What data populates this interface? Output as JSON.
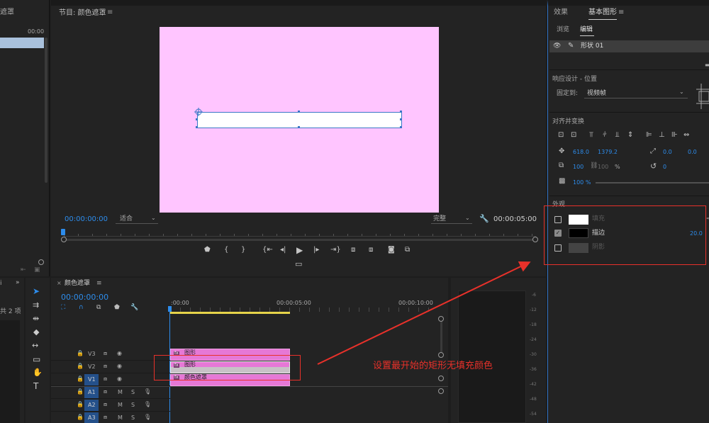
{
  "left_panel": {
    "frag_title": "遮罩",
    "timecode": "00:00"
  },
  "program": {
    "title": "节目: 颜色遮罩",
    "timecode": "00:00:00:00",
    "fit_select": "适合",
    "quality_select": "完整",
    "duration": "00:00:05:00"
  },
  "essential": {
    "tab_effects": "效果",
    "tab_basic": "基本图形",
    "subtab_browse": "浏览",
    "subtab_edit": "编辑",
    "layer_name": "形状 01",
    "responsive_title": "响应设计 - 位置",
    "pin_label": "固定到:",
    "pin_value": "视频帧",
    "align_title": "对齐并变换",
    "pos_x": "618.0",
    "pos_y": "1379.2",
    "anchor_x": "0.0",
    "anchor_y": "0.0",
    "scale": "100",
    "scale2": "100",
    "scale_unit": "%",
    "rotation": "0",
    "opacity": "100 %",
    "appearance_title": "外观",
    "fill_label": "填充",
    "stroke_label": "描边",
    "stroke_width": "20.0",
    "shadow_label": "阴影"
  },
  "timeline": {
    "title": "颜色遮罩",
    "timecode": "00:00:00:00",
    "ruler": [
      ":00:00",
      "00:00:05:00",
      "00:00:10:00"
    ],
    "tracks": [
      {
        "name": "V3"
      },
      {
        "name": "V2"
      },
      {
        "name": "V1"
      },
      {
        "name": "A1",
        "m": "M",
        "s": "S"
      },
      {
        "name": "A2",
        "m": "M",
        "s": "S"
      },
      {
        "name": "A3",
        "m": "M",
        "s": "S"
      }
    ],
    "clips": [
      {
        "label": "图形"
      },
      {
        "label": "图形"
      },
      {
        "label": "颜色遮罩"
      }
    ]
  },
  "project_frag": {
    "count": "共 2 项",
    "tab_frag": "i"
  },
  "meter": {
    "labels": [
      "-6",
      "-12",
      "-18",
      "-24",
      "-30",
      "-36",
      "-42",
      "-48",
      "-54"
    ]
  },
  "annotation": {
    "text": "设置最开始的矩形无填充颜色",
    "color": "#e8312a"
  },
  "colors": {
    "accent": "#2d8ceb",
    "canvas": "#ffc5ff",
    "clip": "#e678d6",
    "annotation": "#e8312a"
  }
}
